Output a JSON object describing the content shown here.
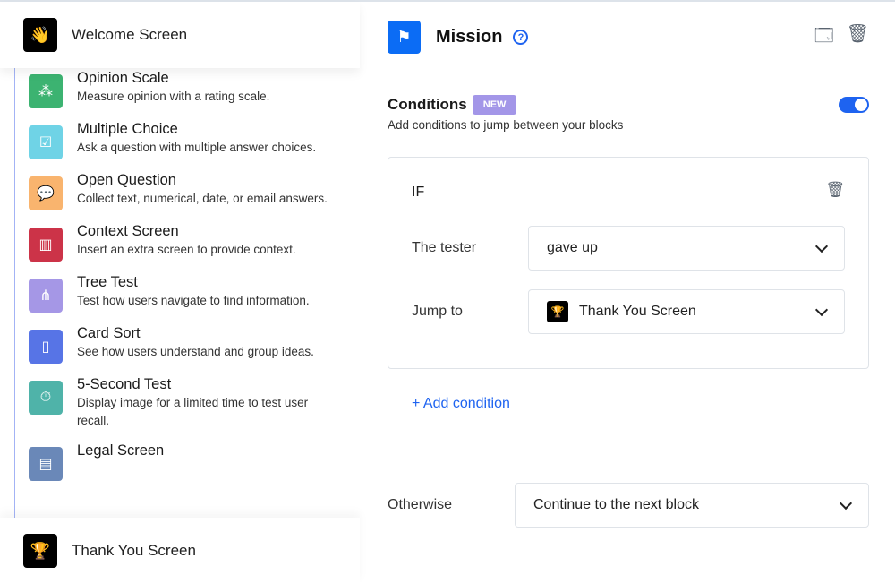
{
  "sidebar": {
    "top": {
      "label": "Welcome Screen",
      "icon": "waving-hand-icon"
    },
    "bottom": {
      "label": "Thank You Screen",
      "icon": "trophy-icon"
    },
    "items": [
      {
        "title": "Opinion Scale",
        "desc": "Measure opinion with a rating scale.",
        "color": "#3cb371",
        "glyph": "⁂",
        "icon": "stars-icon"
      },
      {
        "title": "Multiple Choice",
        "desc": "Ask a question with multiple answer choices.",
        "color": "#6fd3e6",
        "glyph": "☑",
        "icon": "checklist-icon"
      },
      {
        "title": "Open Question",
        "desc": "Collect text, numerical, date, or email answers.",
        "color": "#f9b46e",
        "glyph": "💬",
        "icon": "chat-question-icon"
      },
      {
        "title": "Context Screen",
        "desc": "Insert an extra screen to provide context.",
        "color": "#cc3348",
        "glyph": "▥",
        "icon": "screen-icon"
      },
      {
        "title": "Tree Test",
        "desc": "Test how users navigate to find information.",
        "color": "#a597e6",
        "glyph": "⋔",
        "icon": "tree-icon"
      },
      {
        "title": "Card Sort",
        "desc": "See how users understand and group ideas.",
        "color": "#5774e6",
        "glyph": "▯",
        "icon": "cards-icon"
      },
      {
        "title": "5-Second Test",
        "desc": "Display image for a limited time to test user recall.",
        "color": "#4fb3a9",
        "glyph": "⏱",
        "icon": "stopwatch-icon"
      },
      {
        "title": "Legal Screen",
        "desc": "",
        "color": "#6a88b8",
        "glyph": "▤",
        "icon": "document-icon"
      }
    ]
  },
  "main": {
    "title": "Mission",
    "help": "?",
    "conditions": {
      "title": "Conditions",
      "badge": "NEW",
      "desc": "Add conditions to jump between your blocks",
      "enabled": true
    },
    "rule": {
      "if": "IF",
      "tester_label": "The tester",
      "tester_value": "gave up",
      "jump_label": "Jump to",
      "jump_value": "Thank You Screen"
    },
    "add_condition": "+ Add condition",
    "otherwise_label": "Otherwise",
    "otherwise_value": "Continue to the next block"
  },
  "colors": {
    "accent": "#1e63f0",
    "badge": "#a396e8",
    "mission": "#0b6cf5"
  }
}
